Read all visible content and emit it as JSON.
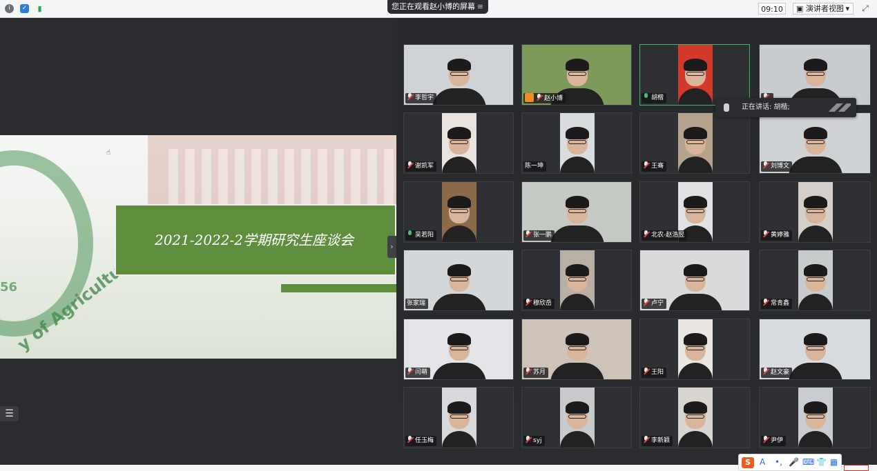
{
  "topbar": {
    "viewing_text": "您正在观看赵小博的屏幕",
    "time": "09:10",
    "view_mode": "演讲者视图",
    "dropdown_arrow": "▾",
    "icons": [
      "info-icon",
      "shield-icon",
      "signal-icon",
      "fullscreen-icon"
    ]
  },
  "slide": {
    "title": "2021-2022-2学期研究生座谈会",
    "emblem_text": "y of Agriculture",
    "emblem_number": "56"
  },
  "speaking": {
    "label": "正在讲话: 胡楷;"
  },
  "participants": [
    {
      "name": "李哲宇",
      "mic": "muted",
      "video": "#cfd3d6"
    },
    {
      "name": "赵小博",
      "mic": "muted",
      "host": true,
      "video": "#7d9a5a"
    },
    {
      "name": "胡楷",
      "mic": "on",
      "video": "#d33a2c",
      "active": true
    },
    {
      "name": "",
      "mic": "muted",
      "video": "#c8ccd0"
    },
    {
      "name": "谢凯军",
      "mic": "muted",
      "video": "#e8e3dc"
    },
    {
      "name": "陈一坤",
      "mic": "none",
      "video": "#d9dde0"
    },
    {
      "name": "王骞",
      "mic": "muted",
      "video": "#b6a38e"
    },
    {
      "name": "刘博文",
      "mic": "muted",
      "video": "#cfd2d4"
    },
    {
      "name": "吴若阳",
      "mic": "on",
      "video": "#8b6b4a"
    },
    {
      "name": "张一鹏",
      "mic": "muted",
      "video": "#c5c9c4"
    },
    {
      "name": "北农-赵浩昱",
      "mic": "muted",
      "video": "#dfe1e3"
    },
    {
      "name": "黄婷雅",
      "mic": "muted",
      "video": "#d4cfca"
    },
    {
      "name": "张家瑞",
      "mic": "none",
      "video": "#d3d7d9"
    },
    {
      "name": "穆欣岳",
      "mic": "muted",
      "video": "#b9b0a5"
    },
    {
      "name": "卢宁",
      "mic": "muted",
      "video": "#d8dadc"
    },
    {
      "name": "常青鑫",
      "mic": "muted",
      "video": "#c8cbcc"
    },
    {
      "name": "闫萌",
      "mic": "muted",
      "video": "#e2e4e7"
    },
    {
      "name": "苏月",
      "mic": "muted",
      "video": "#cdc3b8"
    },
    {
      "name": "王阳",
      "mic": "muted",
      "video": "#e9e6e2"
    },
    {
      "name": "赵文豪",
      "mic": "muted",
      "video": "#d8dce0"
    },
    {
      "name": "任玉梅",
      "mic": "muted",
      "video": "#d7d9dc"
    },
    {
      "name": "syj",
      "mic": "muted",
      "video": "#c8cacb"
    },
    {
      "name": "李新颖",
      "mic": "muted",
      "video": "#d9d6d2"
    },
    {
      "name": "尹伊",
      "mic": "muted",
      "video": "#c9ccd0"
    }
  ],
  "ime": {
    "logo": "S",
    "items": [
      "A",
      "•,",
      "🎤",
      "⌨",
      "👕",
      "▦"
    ]
  }
}
